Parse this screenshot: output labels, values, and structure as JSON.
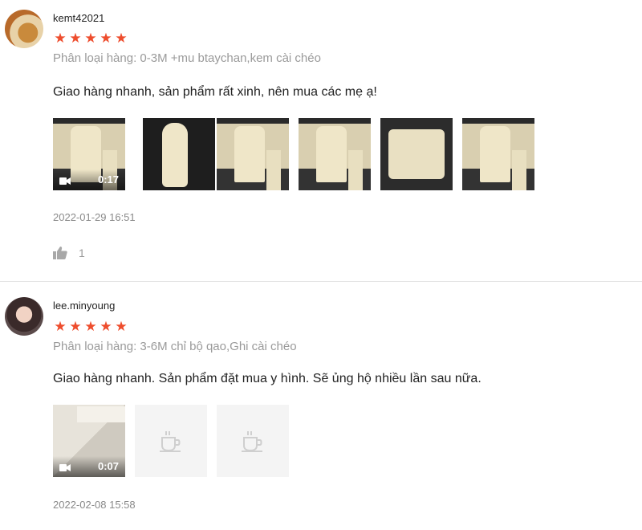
{
  "reviews": [
    {
      "username": "kemt42021",
      "rating": 5,
      "star_glyph": "★",
      "variation": "Phân loại hàng: 0-3M +mu btaychan,kem cài chéo",
      "comment": "Giao hàng nhanh, sản phẩm rất xinh, nên mua các mẹ ạ!",
      "video_duration": "0:17",
      "date": "2022-01-29 16:51",
      "likes": "1"
    },
    {
      "username": "lee.minyoung",
      "rating": 5,
      "star_glyph": "★",
      "variation": "Phân loại hàng: 3-6M chỉ bộ qao,Ghi cài chéo",
      "comment": "Giao hàng nhanh. Sản phẩm đặt mua y hình. Sẽ ủng hộ nhiều lần sau nữa.",
      "video_duration": "0:07",
      "date": "2022-02-08 15:58"
    }
  ],
  "icons": {
    "star": "star-icon",
    "video": "video-camera-icon",
    "placeholder": "image-placeholder-cup-icon",
    "like": "thumbs-up-icon"
  },
  "colors": {
    "star": "#ee4d2d",
    "muted_text": "#9a9a9a",
    "placeholder_bg": "#f4f4f4"
  }
}
